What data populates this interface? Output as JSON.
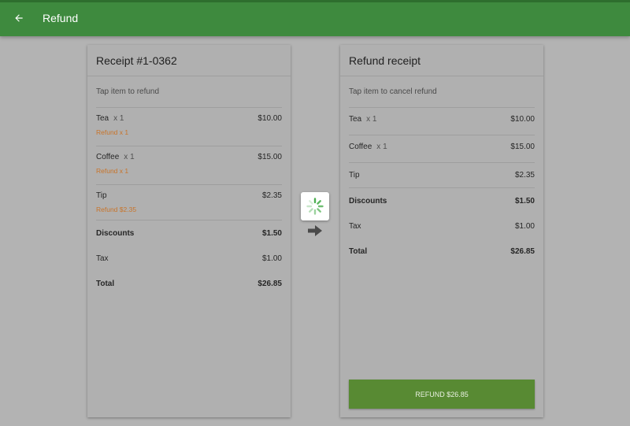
{
  "appbar": {
    "title": "Refund",
    "back_icon": "arrow-left-icon"
  },
  "receipt": {
    "title": "Receipt #1-0362",
    "hint": "Tap item to refund",
    "items": [
      {
        "name": "Tea",
        "qty": "x 1",
        "price": "$10.00",
        "refund": "Refund x 1"
      },
      {
        "name": "Coffee",
        "qty": "x 1",
        "price": "$15.00",
        "refund": "Refund x 1"
      }
    ],
    "tip": {
      "label": "Tip",
      "amount": "$2.35",
      "refund": "Refund $2.35"
    },
    "discounts": {
      "label": "Discounts",
      "amount": "$1.50"
    },
    "tax": {
      "label": "Tax",
      "amount": "$1.00"
    },
    "total": {
      "label": "Total",
      "amount": "$26.85"
    }
  },
  "refund_receipt": {
    "title": "Refund receipt",
    "hint": "Tap item to cancel refund",
    "items": [
      {
        "name": "Tea",
        "qty": "x 1",
        "price": "$10.00"
      },
      {
        "name": "Coffee",
        "qty": "x 1",
        "price": "$15.00"
      }
    ],
    "tip": {
      "label": "Tip",
      "amount": "$2.35"
    },
    "discounts": {
      "label": "Discounts",
      "amount": "$1.50"
    },
    "tax": {
      "label": "Tax",
      "amount": "$1.00"
    },
    "total": {
      "label": "Total",
      "amount": "$26.85"
    },
    "button_label": "REFUND $26.85"
  },
  "colors": {
    "appbar": "#3e8a3e",
    "refund_text": "#c8742a",
    "refund_button": "#588a33",
    "spinner": "#4caf50"
  }
}
